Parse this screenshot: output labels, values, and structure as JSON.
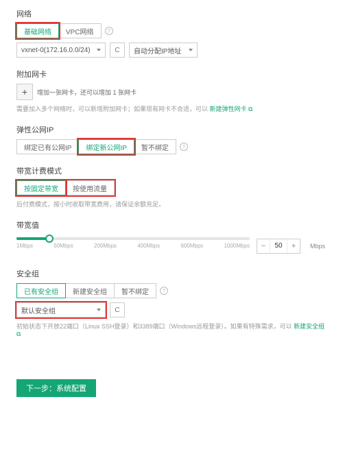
{
  "network": {
    "title": "网络",
    "tabs": {
      "basic": "基础网络",
      "vpc": "VPC网络"
    },
    "subnet_select": "vxnet-0(172.16.0.0/24)",
    "refresh_icon": "C",
    "ip_mode_select": "自动分配IP地址"
  },
  "nic": {
    "title": "附加网卡",
    "add_label": "增加一张网卡，还可以增加 1 张网卡",
    "hint_prefix": "需要加入多个网络时，可以新增附加网卡；如果现有网卡不合适，可以 ",
    "hint_link": "新建弹性网卡"
  },
  "eip": {
    "title": "弹性公网IP",
    "tabs": {
      "bind_existing": "绑定已有公网IP",
      "bind_new": "绑定新公网IP",
      "none": "暂不绑定"
    }
  },
  "billing": {
    "title": "带宽计费模式",
    "tabs": {
      "fixed": "按固定带宽",
      "traffic": "按使用流量"
    },
    "hint": "后付费模式，按小时收取带宽费用，请保证余额充足。"
  },
  "bandwidth": {
    "title": "带宽值",
    "ticks": [
      "1Mbps",
      "50Mbps",
      "200Mbps",
      "400Mbps",
      "600Mbps",
      "1000Mbps"
    ],
    "value": "50",
    "unit": "Mbps"
  },
  "sg": {
    "title": "安全组",
    "tabs": {
      "existing": "已有安全组",
      "new": "新建安全组",
      "none": "暂不绑定"
    },
    "select": "默认安全组",
    "refresh_icon": "C",
    "hint_prefix": "初始状态下开放22端口（Linux SSH登录）和3389端口（Windows远程登录）。如果有特殊需求，可以 ",
    "hint_link": "新建安全组"
  },
  "footer": {
    "next": "下一步：系统配置"
  }
}
